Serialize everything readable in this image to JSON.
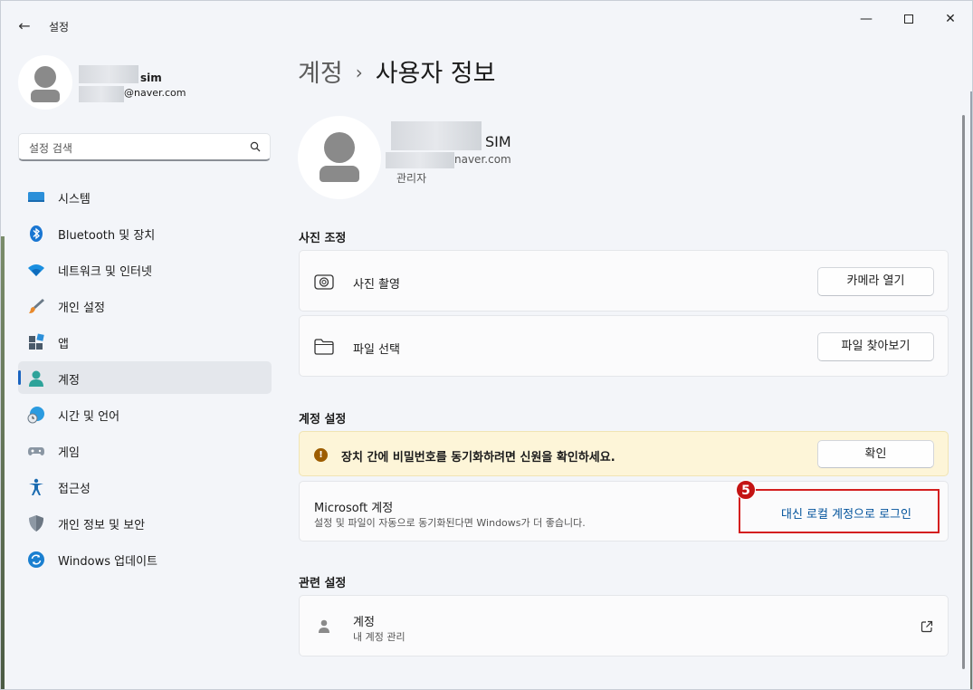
{
  "window": {
    "app_title": "설정",
    "back_glyph": "←",
    "min_glyph": "—",
    "close_glyph": "✕"
  },
  "sidebar": {
    "profile": {
      "name": "sim",
      "email": "@naver.com"
    },
    "search": {
      "placeholder": "설정 검색"
    },
    "items": [
      {
        "label": "시스템",
        "icon": "monitor-icon"
      },
      {
        "label": "Bluetooth 및 장치",
        "icon": "bluetooth-icon"
      },
      {
        "label": "네트워크 및 인터넷",
        "icon": "wifi-icon"
      },
      {
        "label": "개인 설정",
        "icon": "paintbrush-icon"
      },
      {
        "label": "앱",
        "icon": "apps-icon"
      },
      {
        "label": "계정",
        "icon": "person-icon",
        "active": true
      },
      {
        "label": "시간 및 언어",
        "icon": "globe-clock-icon"
      },
      {
        "label": "게임",
        "icon": "gamepad-icon"
      },
      {
        "label": "접근성",
        "icon": "accessibility-icon"
      },
      {
        "label": "개인 정보 및 보안",
        "icon": "shield-icon"
      },
      {
        "label": "Windows 업데이트",
        "icon": "sync-icon"
      }
    ]
  },
  "breadcrumb": {
    "parent": "계정",
    "separator": "›",
    "current": "사용자 정보"
  },
  "user": {
    "name": "SIM",
    "email": "naver.com",
    "role": "관리자"
  },
  "photo_section": {
    "title": "사진 조정",
    "take_photo": {
      "label": "사진 촬영",
      "button": "카메라 열기"
    },
    "choose_file": {
      "label": "파일 선택",
      "button": "파일 찾아보기"
    }
  },
  "account_section": {
    "title": "계정 설정",
    "warning": {
      "icon_glyph": "!",
      "text": "장치 간에 비밀번호를 동기화하려면 신원을 확인하세요.",
      "button": "확인"
    },
    "microsoft": {
      "title": "Microsoft 계정",
      "description": "설정 및 파일이 자동으로 동기화된다면 Windows가 더 좋습니다.",
      "link": "대신 로컬 계정으로 로그인"
    },
    "step_badge": "5"
  },
  "related_section": {
    "title": "관련 설정",
    "account": {
      "title": "계정",
      "description": "내 계정 관리"
    }
  },
  "colors": {
    "accent": "#1a64c0",
    "link": "#00529b",
    "highlight": "#d41f1f",
    "warning_bg": "#fdf5d8"
  }
}
